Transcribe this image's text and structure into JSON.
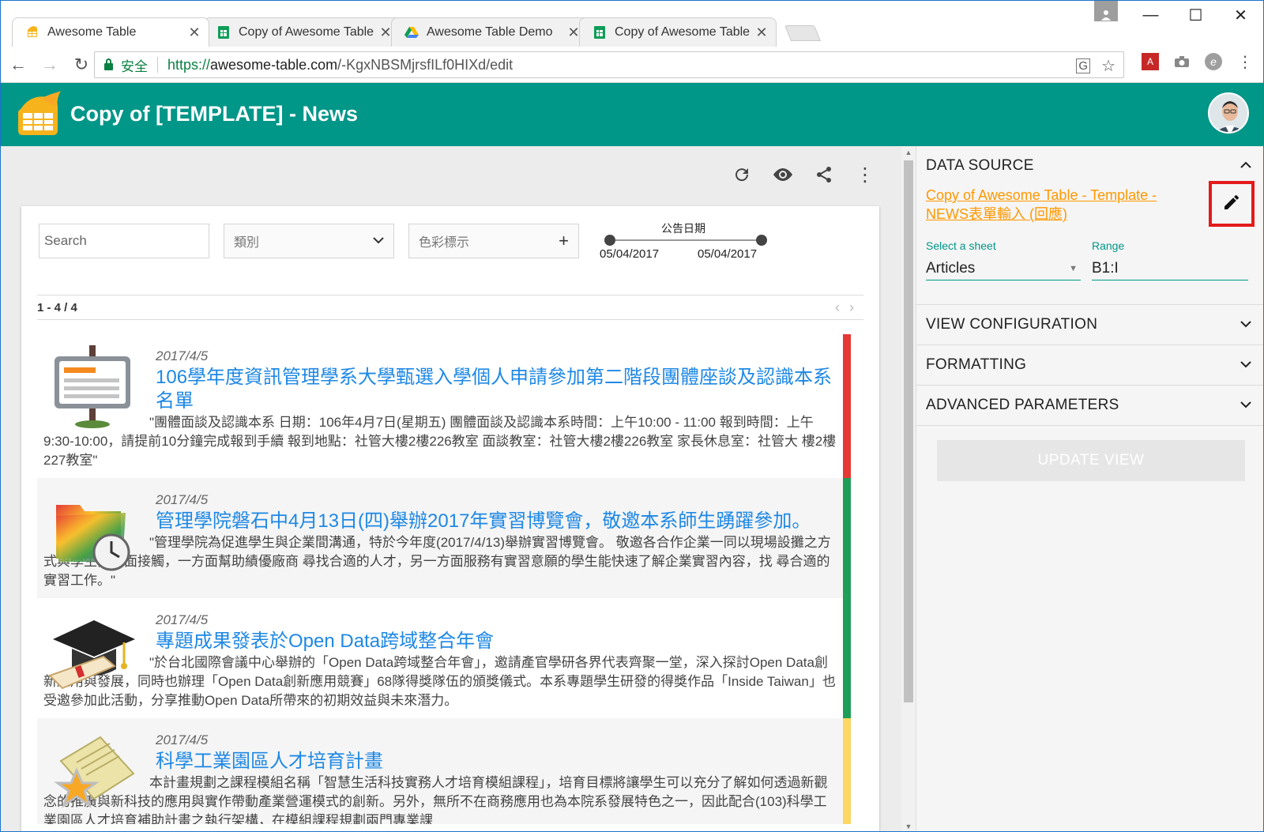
{
  "browser": {
    "tabs": [
      {
        "title": "Awesome Table",
        "icon": "awesome-table-icon",
        "active": true
      },
      {
        "title": "Copy of Awesome Table",
        "icon": "sheets-icon",
        "active": false
      },
      {
        "title": "Awesome Table Demo",
        "icon": "drive-icon",
        "active": false
      },
      {
        "title": "Copy of Awesome Table",
        "icon": "sheets-icon",
        "active": false
      }
    ],
    "secure_label": "安全",
    "url_scheme": "https://",
    "url_host": "awesome-table.com",
    "url_path": "/-KgxNBSMjrsfILf0HIXd/edit"
  },
  "app": {
    "title": "Copy of [TEMPLATE] - News",
    "brand_color": "#009688"
  },
  "filters": {
    "search_placeholder": "Search",
    "category_label": "類別",
    "color_label": "色彩標示",
    "date_range_label": "公告日期",
    "date_from": "05/04/2017",
    "date_to": "05/04/2017"
  },
  "pager": {
    "count": "1 - 4 / 4"
  },
  "results": [
    {
      "date": "2017/4/5",
      "title": "106學年度資訊管理學系大學甄選入學個人申請參加第二階段團體座談及認識本系名單",
      "desc": "\"團體面談及認識本系 日期：106年4月7日(星期五) 團體面談及認識本系時間：上午10:00 - 11:00 報到時間：上午9:30-10:00，請提前10分鐘完成報到手續 報到地點：社管大樓2樓226教室 面談教室：社管大樓2樓226教室 家長休息室：社管大 樓2樓227教室\"",
      "color": "#e53935",
      "icon": "signboard-icon"
    },
    {
      "date": "2017/4/5",
      "title": "管理學院磐石中4月13日(四)舉辦2017年實習博覽會，敬邀本系師生踴躍參加。",
      "desc": "\"管理學院為促進學生與企業間溝通，特於今年度(2017/4/13)舉辦實習博覽會。 敬邀各合作企業一同以現場設攤之方式與學生面對面接觸，一方面幫助績優廠商 尋找合適的人才，另一方面服務有實習意願的學生能快速了解企業實習內容，找 尋合適的實習工作。\"",
      "color": "#1e9e56",
      "icon": "folder-clock-icon"
    },
    {
      "date": "2017/4/5",
      "title": "專題成果發表於Open Data跨域整合年會",
      "desc": "\"於台北國際會議中心舉辦的「Open Data跨域整合年會」，邀請產官學研各界代表齊聚一堂，深入探討Open Data創新應用與發展，同時也辦理「Open Data創新應用競賽」68隊得獎隊伍的頒獎儀式。本系專題學生研發的得獎作品「Inside Taiwan」也受邀參加此活動，分享推動Open Data所帶來的初期效益與未來潛力。",
      "color": "#1e9e56",
      "icon": "graduation-cap-icon"
    },
    {
      "date": "2017/4/5",
      "title": "科學工業園區人才培育計畫",
      "desc": "本計畫規劃之課程模組名稱「智慧生活科技實務人才培育模組課程」，培育目標將讓學生可以充分了解如何透過新觀念的推廣與新科技的應用與實作帶動產業營運模式的創新。另外，無所不在商務應用也為本院系發展特色之一，因此配合(103)科學工業園區人才培育補助計畫之執行架構，在模組課程規劃兩門專業課",
      "color": "#fdd663",
      "icon": "certificate-star-icon"
    }
  ],
  "panel": {
    "data_source_label": "DATA SOURCE",
    "data_source_link": "Copy of Awesome Table - Template - NEWS表單輸入 (回應)",
    "sheet_label": "Select a sheet",
    "sheet_value": "Articles",
    "range_label": "Range",
    "range_value": "B1:I",
    "view_config_label": "VIEW CONFIGURATION",
    "formatting_label": "FORMATTING",
    "advanced_label": "ADVANCED PARAMETERS",
    "update_label": "UPDATE VIEW"
  }
}
